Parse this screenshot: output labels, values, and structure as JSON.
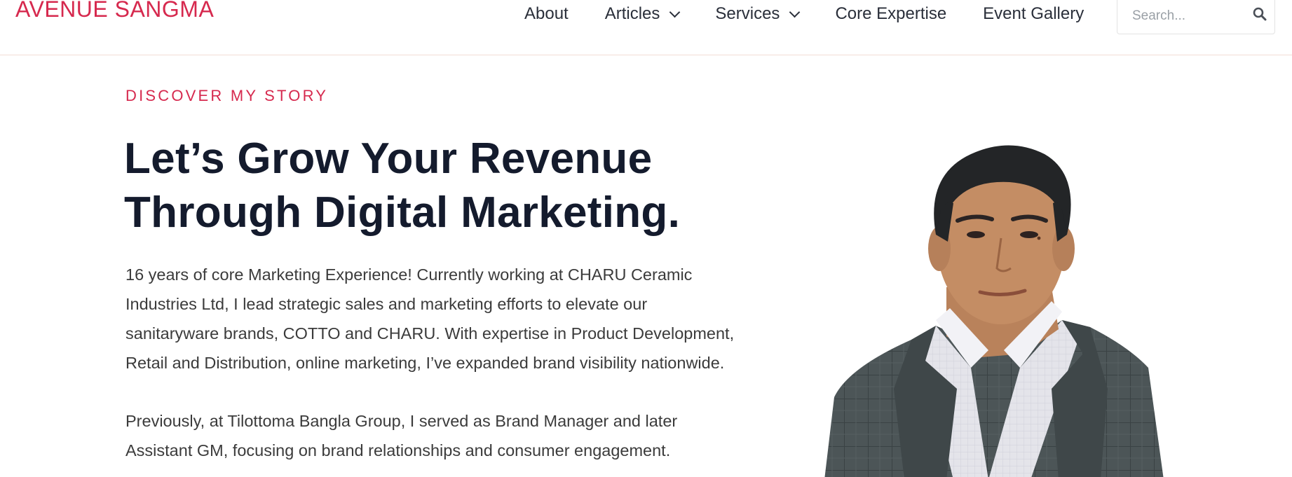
{
  "header": {
    "logo": "AVENUE SANGMA",
    "nav": [
      {
        "label": "About",
        "has_dropdown": false
      },
      {
        "label": "Articles",
        "has_dropdown": true
      },
      {
        "label": "Services",
        "has_dropdown": true
      },
      {
        "label": "Core Expertise",
        "has_dropdown": false
      },
      {
        "label": "Event Gallery",
        "has_dropdown": false
      }
    ],
    "search": {
      "placeholder": "Search...",
      "value": "",
      "icon": "search-icon"
    }
  },
  "hero": {
    "eyebrow": "DISCOVER MY STORY",
    "headline_line1": "Let’s Grow Your Revenue",
    "headline_line2": "Through Digital Marketing.",
    "para1_lines": [
      "16 years of core Marketing Experience! Currently working at CHARU Ceramic",
      "Industries Ltd, I lead strategic sales and marketing efforts to elevate our",
      "sanitaryware brands, COTTO and CHARU. With expertise in Product Development,",
      "Retail and Distribution, online marketing, I’ve expanded brand visibility nationwide."
    ],
    "para2_lines": [
      "Previously, at Tilottoma Bangla Group, I served as Brand Manager and later",
      "Assistant GM, focusing on brand relationships and consumer engagement."
    ],
    "portrait": "portrait-photo"
  },
  "colors": {
    "accent": "#d6294e",
    "heading": "#141b2d",
    "body_text": "#3b3b3b",
    "header_border": "#f2ddd5"
  }
}
